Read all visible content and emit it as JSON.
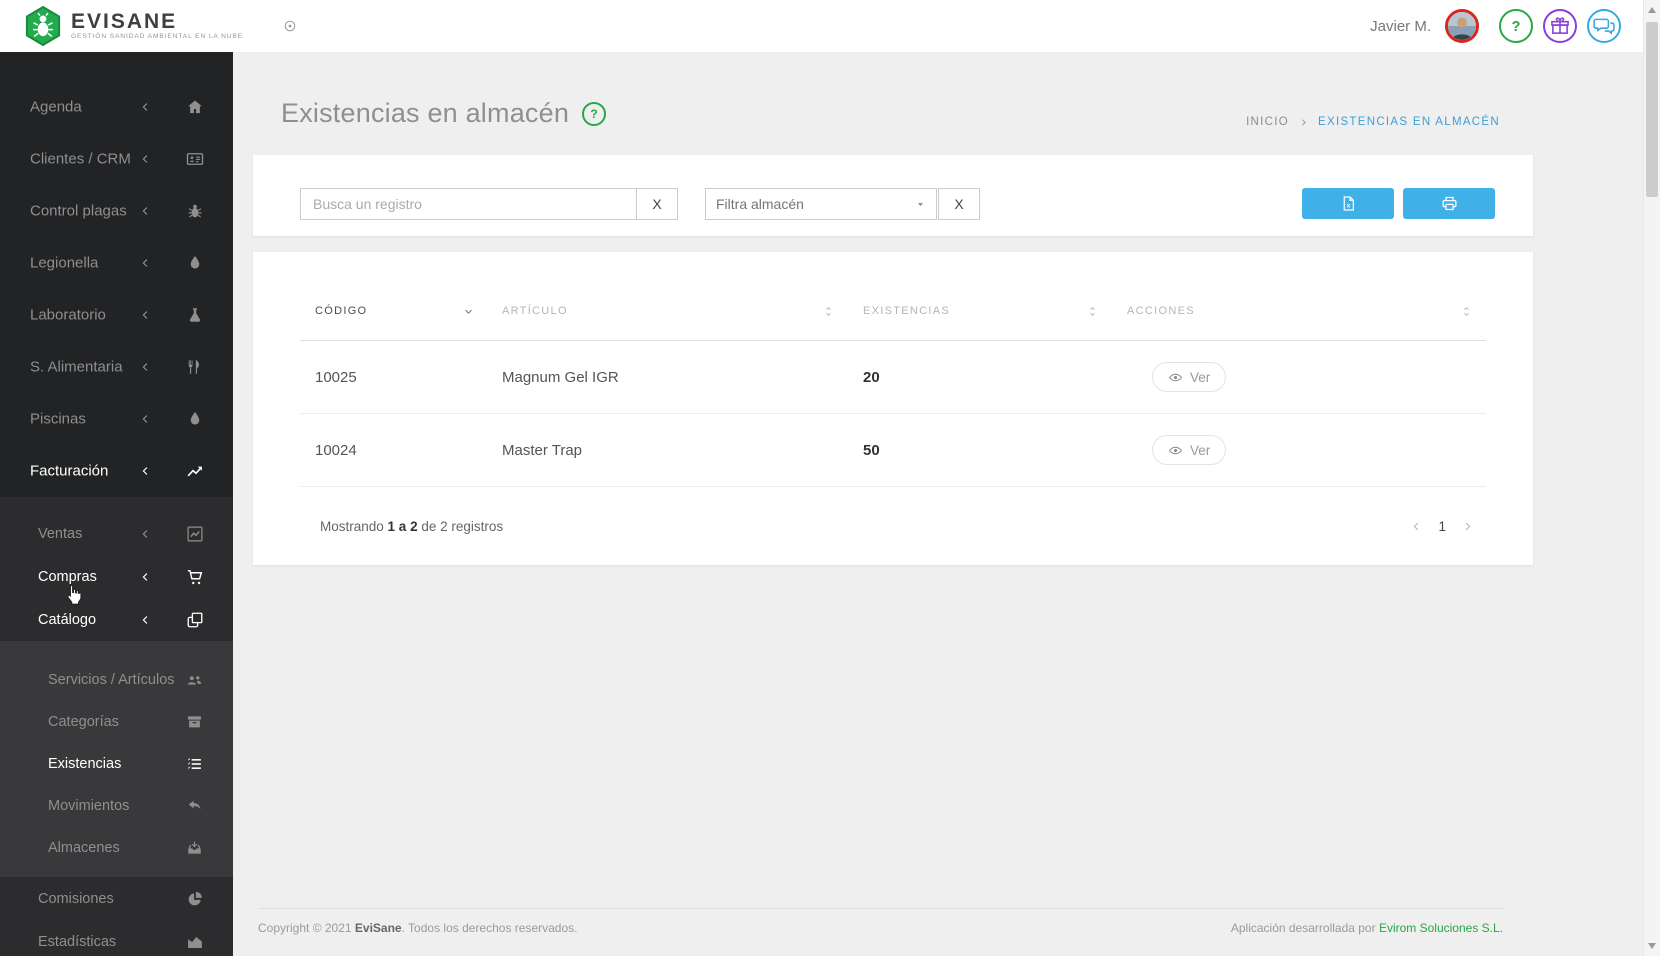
{
  "colors": {
    "accent_blue": "#3fb0e8",
    "breadcrumb_blue": "#3d9fd6",
    "accent_green": "#28a745",
    "gift_purple": "#8b3fd6",
    "chat_blue": "#36aae0",
    "avatar_ring_red": "#d6281e",
    "sidebar_bg": "#222325",
    "sidebar_submenu_bg": "#2c2c2e",
    "sidebar_subsubmenu_bg": "#39393b",
    "content_bg": "#efefef"
  },
  "header": {
    "brand": "EVISANE",
    "tagline": "GESTIÓN SANIDAD AMBIENTAL EN LA NUBE",
    "user_name": "Javier M."
  },
  "icons": {
    "target": "target-icon",
    "help": "question-icon",
    "gift": "gift-icon",
    "chat": "chat-icon",
    "sidebar_chevron": "chevron-left-icon",
    "title_help": "question-icon",
    "breadcrumb_separator": "chevron-right-icon",
    "select_caret": "caret-down-icon",
    "export": "excel-file-icon",
    "print": "printer-icon",
    "eye": "eye-icon",
    "pagination_prev": "chevron-left-icon",
    "pagination_next": "chevron-right-icon"
  },
  "sidebar": {
    "main": [
      {
        "label": "Agenda",
        "icon": "home-icon"
      },
      {
        "label": "Clientes / CRM",
        "icon": "id-card-icon"
      },
      {
        "label": "Control plagas",
        "icon": "bug-icon"
      },
      {
        "label": "Legionella",
        "icon": "droplet-icon"
      },
      {
        "label": "Laboratorio",
        "icon": "flask-icon"
      },
      {
        "label": "S. Alimentaria",
        "icon": "utensils-icon"
      },
      {
        "label": "Piscinas",
        "icon": "droplet-icon"
      },
      {
        "label": "Facturación",
        "icon": "chart-line-icon"
      }
    ],
    "facturacion_submenu": [
      {
        "label": "Ventas",
        "icon": "chart-box-icon"
      },
      {
        "label": "Compras",
        "icon": "cart-icon"
      },
      {
        "label": "Catálogo",
        "icon": "copy-icon"
      }
    ],
    "catalogo_submenu": [
      {
        "label": "Servicios / Artículos",
        "icon": "users-icon"
      },
      {
        "label": "Categorías",
        "icon": "archive-icon"
      },
      {
        "label": "Existencias",
        "icon": "list-icon"
      },
      {
        "label": "Movimientos",
        "icon": "undo-icon"
      },
      {
        "label": "Almacenes",
        "icon": "inbox-icon"
      }
    ],
    "facturacion_submenu_tail": [
      {
        "label": "Comisiones",
        "icon": "pie-chart-icon"
      },
      {
        "label": "Estadísticas",
        "icon": "area-chart-icon"
      }
    ]
  },
  "page": {
    "title": "Existencias en almacén"
  },
  "breadcrumb": {
    "home": "INICIO",
    "current": "EXISTENCIAS EN ALMACÉN"
  },
  "filters": {
    "search_placeholder": "Busca un registro",
    "clear_label": "X",
    "warehouse_placeholder": "Filtra almacén"
  },
  "table": {
    "columns": [
      {
        "label": "CÓDIGO",
        "sort_icon": "chevron-down-icon"
      },
      {
        "label": "ARTÍCULO",
        "sort_icon": "sort-icon"
      },
      {
        "label": "EXISTENCIAS",
        "sort_icon": "sort-icon"
      },
      {
        "label": "ACCIONES",
        "sort_icon": "sort-icon"
      }
    ],
    "rows": [
      {
        "codigo": "10025",
        "articulo": "Magnum Gel IGR",
        "existencias": "20",
        "action": "Ver"
      },
      {
        "codigo": "10024",
        "articulo": "Master Trap",
        "existencias": "50",
        "action": "Ver"
      }
    ],
    "summary": {
      "prefix": "Mostrando ",
      "bold": "1 a 2",
      "suffix": " de 2 registros"
    },
    "pagination": {
      "page": "1"
    }
  },
  "footer": {
    "copyright_prefix": "Copyright © 2021 ",
    "brand": "EviSane",
    "copyright_suffix": ". Todos los derechos reservados.",
    "developed_prefix": "Aplicación desarrollada por ",
    "developer": "Evirom Soluciones S.L."
  }
}
